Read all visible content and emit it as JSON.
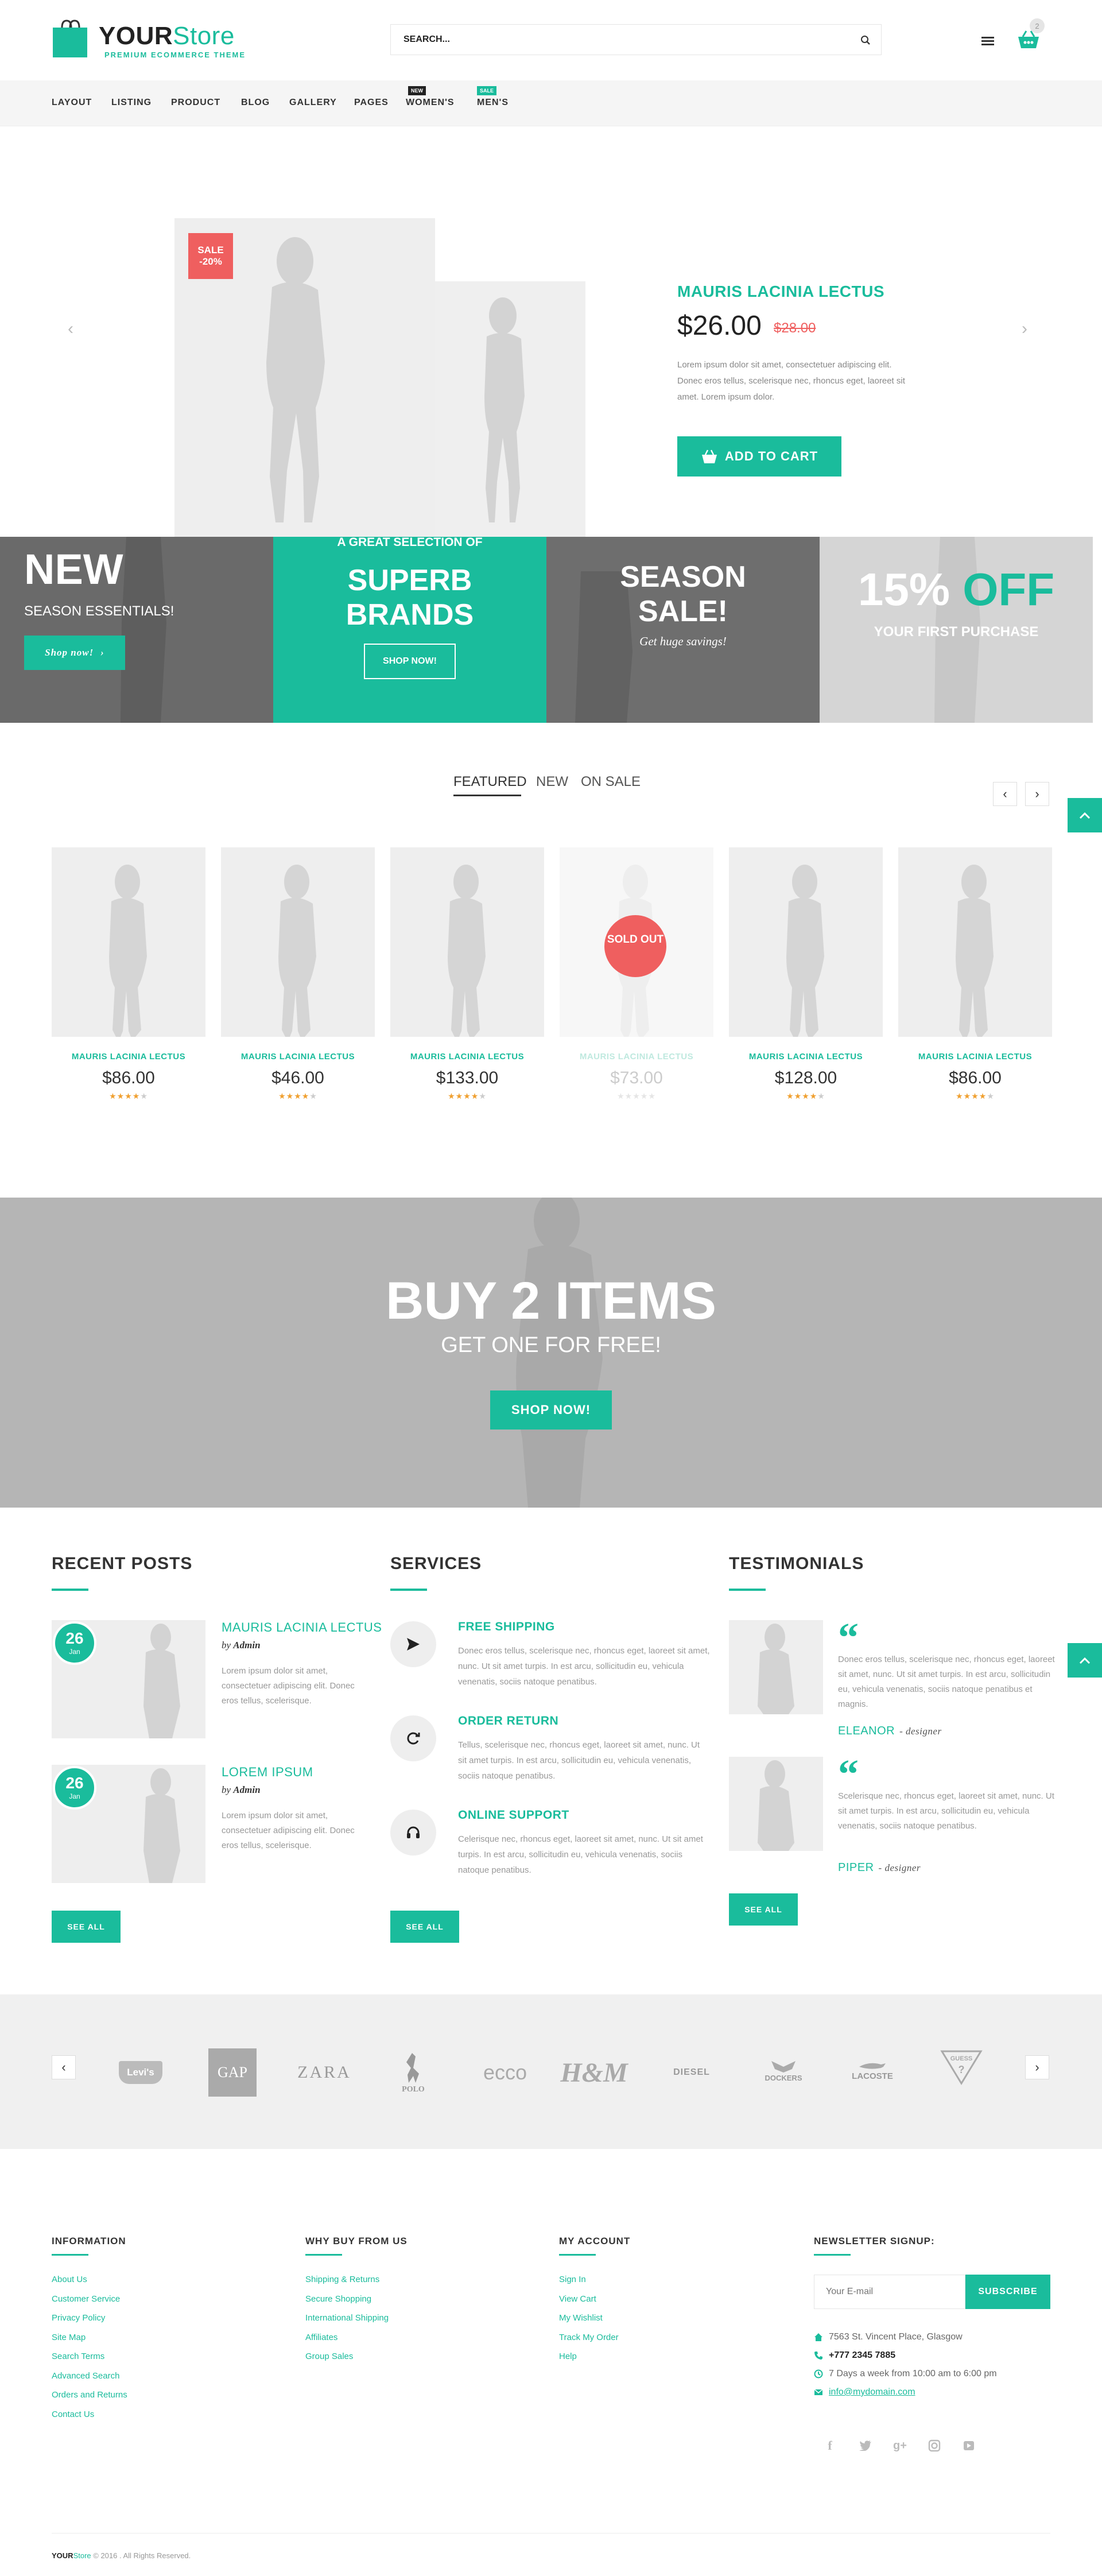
{
  "header": {
    "logo_main": "YOUR",
    "logo_accent": "Store",
    "tagline": "PREMIUM ECOMMERCE THEME",
    "search_placeholder": "SEARCH...",
    "cart_count": "2"
  },
  "nav": {
    "items": [
      "LAYOUT",
      "LISTING",
      "PRODUCT",
      "BLOG",
      "GALLERY",
      "PAGES",
      "WOMEN'S",
      "MEN'S"
    ],
    "badge_new": "NEW",
    "badge_sale": "SALE"
  },
  "hero": {
    "sale_label": "SALE",
    "sale_percent": "-20%",
    "title": "MAURIS LACINIA LECTUS",
    "price": "$26.00",
    "old_price": "$28.00",
    "description": "Lorem ipsum dolor sit amet, consectetuer adipiscing elit. Donec eros tellus, scelerisque nec, rhoncus eget, laoreet sit amet. Lorem ipsum dolor.",
    "button": "ADD TO CART",
    "prev": "‹",
    "next": "›"
  },
  "banners": {
    "b1_title": "NEW",
    "b1_sub": "SEASON ESSENTIALS!",
    "b1_button": "Shop now!",
    "b2_pre": "A GREAT SELECTION OF",
    "b2_title1": "SUPERB",
    "b2_title2": "BRANDS",
    "b2_button": "SHOP NOW!",
    "b3_title1": "SEASON",
    "b3_title2": "SALE!",
    "b3_sub": "Get huge savings!",
    "b4_num": "15%",
    "b4_off": "OFF",
    "b4_sub": "YOUR FIRST PURCHASE"
  },
  "tabs": [
    "FEATURED",
    "NEW",
    "ON SALE"
  ],
  "products": [
    {
      "name": "MAURIS LACINIA LECTUS",
      "price": "$86.00",
      "rating": 4
    },
    {
      "name": "MAURIS LACINIA LECTUS",
      "price": "$46.00",
      "rating": 4
    },
    {
      "name": "MAURIS LACINIA LECTUS",
      "price": "$133.00",
      "rating": 4
    },
    {
      "name": "MAURIS LACINIA LECTUS",
      "price": "$73.00",
      "rating": 0,
      "sold_out": "SOLD OUT"
    },
    {
      "name": "MAURIS LACINIA LECTUS",
      "price": "$128.00",
      "rating": 4
    },
    {
      "name": "MAURIS LACINIA LECTUS",
      "price": "$86.00",
      "rating": 4
    }
  ],
  "promo": {
    "title": "BUY 2 ITEMS",
    "subtitle": "GET ONE FOR FREE!",
    "button": "SHOP NOW!"
  },
  "recent_posts": {
    "title": "RECENT POSTS",
    "posts": [
      {
        "day": "26",
        "month": "Jan",
        "title": "MAURIS LACINIA LECTUS",
        "by": "by",
        "author": "Admin",
        "text": "Lorem ipsum dolor sit amet, consectetuer adipiscing elit. Donec eros tellus, scelerisque."
      },
      {
        "day": "26",
        "month": "Jan",
        "title": "LOREM IPSUM",
        "by": "by",
        "author": "Admin",
        "text": "Lorem ipsum dolor sit amet, consectetuer adipiscing elit. Donec eros tellus, scelerisque."
      }
    ],
    "button": "SEE ALL"
  },
  "services": {
    "title": "SERVICES",
    "items": [
      {
        "title": "FREE SHIPPING",
        "text": "Donec eros tellus, scelerisque nec, rhoncus eget, laoreet sit amet, nunc. Ut sit amet turpis. In est arcu, sollicitudin eu, vehicula venenatis, sociis natoque penatibus."
      },
      {
        "title": "ORDER RETURN",
        "text": "Tellus, scelerisque nec, rhoncus eget, laoreet sit amet, nunc. Ut sit amet turpis. In est arcu, sollicitudin eu, vehicula venenatis, sociis natoque penatibus."
      },
      {
        "title": "ONLINE SUPPORT",
        "text": "Celerisque nec, rhoncus eget, laoreet sit amet, nunc. Ut sit amet turpis. In est arcu, sollicitudin eu, vehicula venenatis, sociis natoque penatibus."
      }
    ],
    "button": "SEE ALL"
  },
  "testimonials": {
    "title": "TESTIMONIALS",
    "items": [
      {
        "text": "Donec eros tellus, scelerisque nec, rhoncus eget, laoreet sit amet, nunc. Ut sit amet turpis. In est arcu, sollicitudin eu, vehicula venenatis, sociis natoque penatibus et magnis.",
        "name": "ELEANOR",
        "role": "designer"
      },
      {
        "text": "Scelerisque nec, rhoncus eget, laoreet sit amet, nunc. Ut sit amet turpis. In est arcu, sollicitudin eu, vehicula venenatis, sociis natoque penatibus.",
        "name": "PIPER",
        "role": "designer"
      }
    ],
    "button": "SEE ALL"
  },
  "brands": [
    "Levi's",
    "GAP",
    "ZARA",
    "POLO",
    "ecco",
    "H&M",
    "DIESEL",
    "DOCKERS",
    "LACOSTE",
    "GUESS"
  ],
  "footer": {
    "information": {
      "title": "INFORMATION",
      "links": [
        "About Us",
        "Customer Service",
        "Privacy Policy",
        "Site Map",
        "Search Terms",
        "Advanced Search",
        "Orders and Returns",
        "Contact Us"
      ]
    },
    "why_buy": {
      "title": "WHY BUY FROM US",
      "links": [
        "Shipping & Returns",
        "Secure Shopping",
        "International Shipping",
        "Affiliates",
        "Group Sales"
      ]
    },
    "account": {
      "title": "MY ACCOUNT",
      "links": [
        "Sign In",
        "View Cart",
        "My Wishlist",
        "Track My Order",
        "Help"
      ]
    },
    "newsletter": {
      "title": "NEWSLETTER SIGNUP:",
      "placeholder": "Your E-mail",
      "button": "SUBSCRIBE"
    },
    "address": "7563 St. Vincent Place, Glasgow",
    "phone": "+777 2345 7885",
    "hours": "7 Days a week from 10:00 am to 6:00 pm",
    "email": "info@mydomain.com",
    "copyright_main": "YOUR",
    "copyright_accent": "Store",
    "copyright_rest": "© 2016 . All Rights Reserved."
  },
  "colors": {
    "accent": "#1abc9c",
    "sale": "#ef5f5f",
    "star": "#f0a030"
  }
}
